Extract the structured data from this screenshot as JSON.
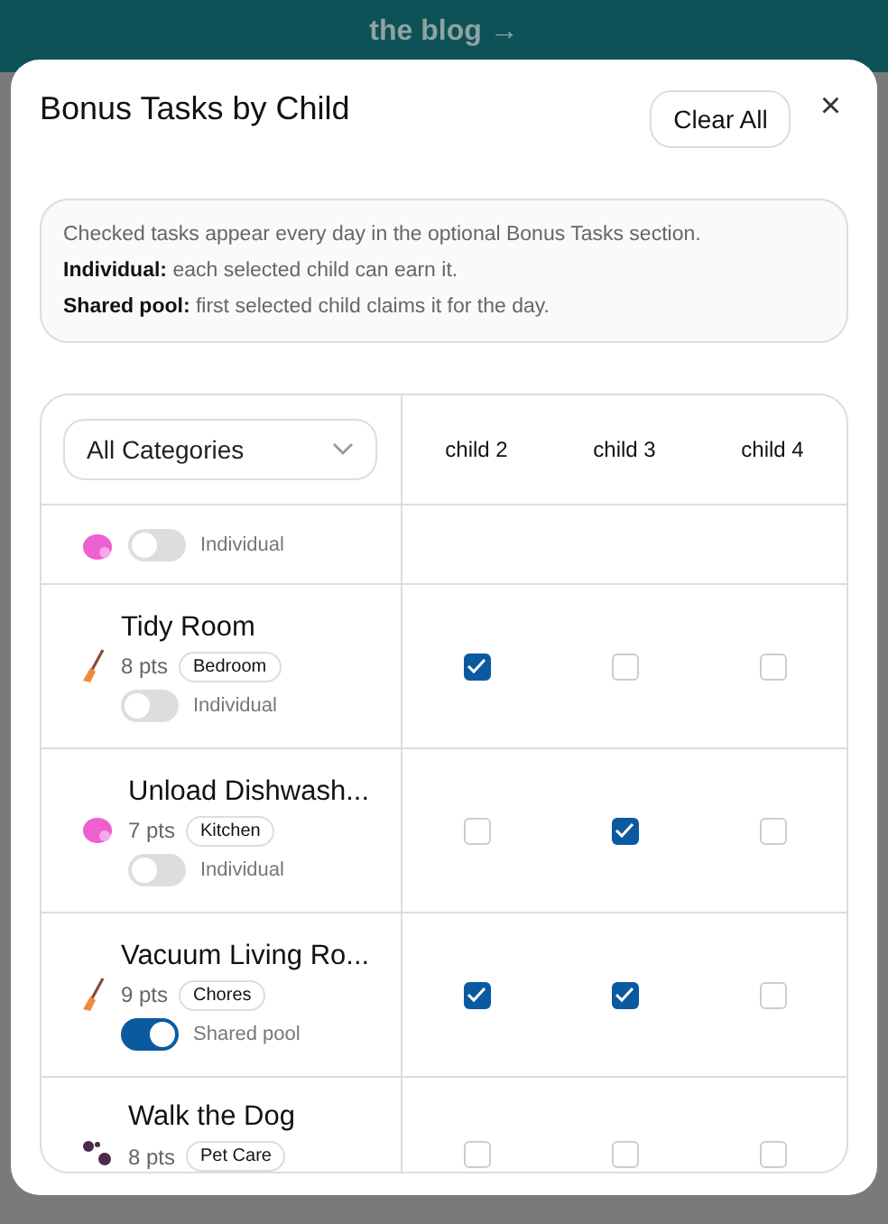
{
  "banner": {
    "lines": [
      "the blog →"
    ]
  },
  "dialog": {
    "title": "Bonus Tasks by Child",
    "clear_button": "Clear All",
    "close": "×"
  },
  "info": [
    "Checked tasks appear every day in the optional Bonus Tasks section.",
    "**Individual:** each selected child can earn it.",
    "**Shared pool:** first selected child claims it for the day."
  ],
  "filter": {
    "value": "All Categories"
  },
  "children": [
    "child 2",
    "child 3",
    "child 4"
  ],
  "tasks": [
    {
      "kind": "partial",
      "mode": "Individual",
      "shared": false
    },
    {
      "kind": "full",
      "name": "Tidy Room",
      "points": "8 pts",
      "category": "Bedroom",
      "mode": "Individual",
      "shared": false,
      "checks": [
        true,
        false,
        false
      ]
    },
    {
      "kind": "full",
      "name": "Unload Dishwash...",
      "points": "7 pts",
      "category": "Kitchen",
      "mode": "Individual",
      "shared": false,
      "checks": [
        false,
        true,
        false
      ]
    },
    {
      "kind": "full",
      "name": "Vacuum Living Ro...",
      "points": "9 pts",
      "category": "Chores",
      "mode": "Shared pool",
      "shared": true,
      "checks": [
        true,
        true,
        false
      ]
    },
    {
      "kind": "cut",
      "name": "Walk the Dog",
      "points": "8 pts",
      "category": "Pet Care",
      "checks": [
        false,
        false,
        false
      ]
    }
  ]
}
